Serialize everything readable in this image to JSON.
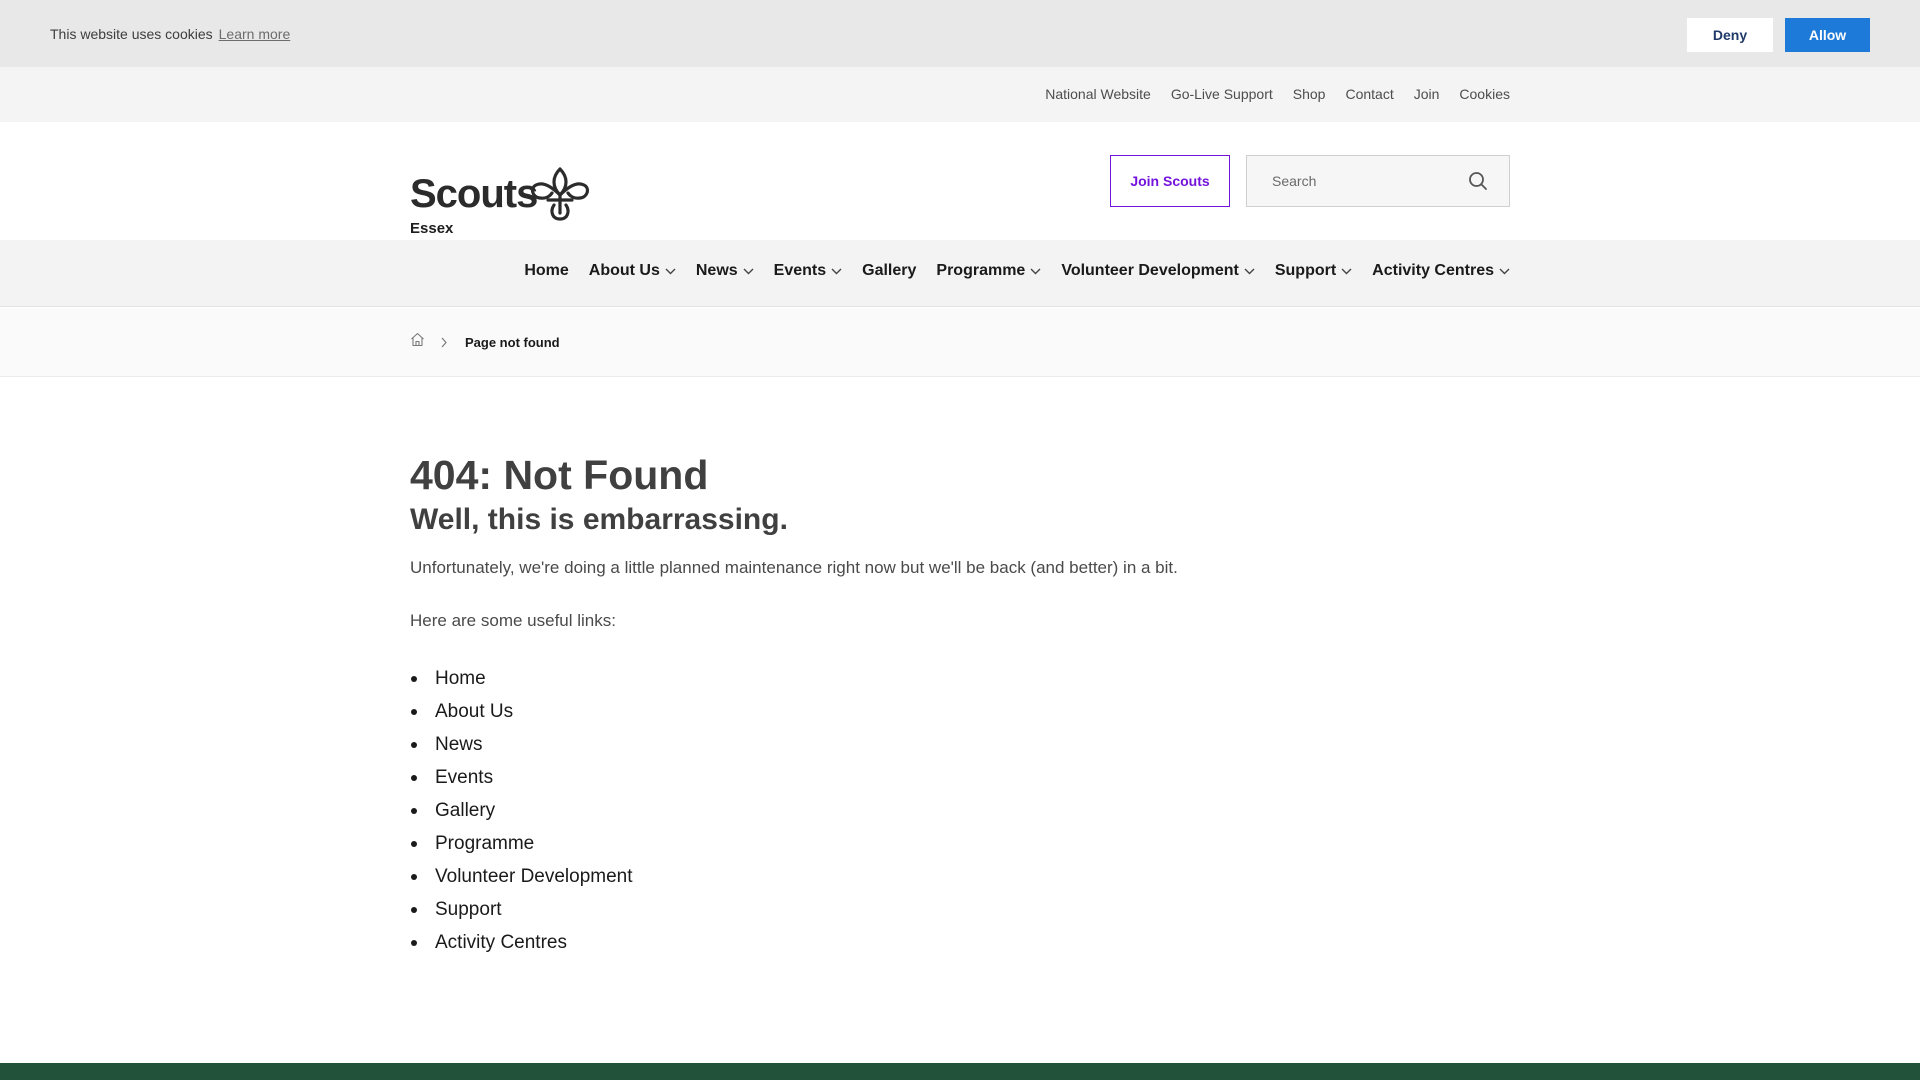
{
  "cookie_bar": {
    "message": "This website uses cookies",
    "learn_more": "Learn more",
    "deny_label": "Deny",
    "allow_label": "Allow"
  },
  "utility_nav": {
    "items": [
      "National Website",
      "Go-Live Support",
      "Shop",
      "Contact",
      "Join",
      "Cookies"
    ]
  },
  "header": {
    "logo_word": "Scouts",
    "logo_sub": "Essex",
    "join_label": "Join Scouts",
    "search_placeholder": "Search"
  },
  "main_nav": {
    "items": [
      {
        "label": "Home",
        "has_dropdown": false
      },
      {
        "label": "About Us",
        "has_dropdown": true
      },
      {
        "label": "News",
        "has_dropdown": true
      },
      {
        "label": "Events",
        "has_dropdown": true
      },
      {
        "label": "Gallery",
        "has_dropdown": false
      },
      {
        "label": "Programme",
        "has_dropdown": true
      },
      {
        "label": "Volunteer Development",
        "has_dropdown": true
      },
      {
        "label": "Support",
        "has_dropdown": true
      },
      {
        "label": "Activity Centres",
        "has_dropdown": true
      }
    ]
  },
  "breadcrumb": {
    "current": "Page not found"
  },
  "content": {
    "title": "404: Not Found",
    "subtitle": "Well, this is embarrassing.",
    "paragraph_1": "Unfortunately, we're doing a little planned maintenance right now but we'll be back (and better) in a bit.",
    "paragraph_2": "Here are some useful links:",
    "links": [
      "Home",
      "About Us",
      "News",
      "Events",
      "Gallery",
      "Programme",
      "Volunteer Development",
      "Support",
      "Activity Centres"
    ]
  },
  "colors": {
    "accent_purple": "#7413dc",
    "allow_blue": "#1e7ad8",
    "footer_green": "#23523a"
  }
}
